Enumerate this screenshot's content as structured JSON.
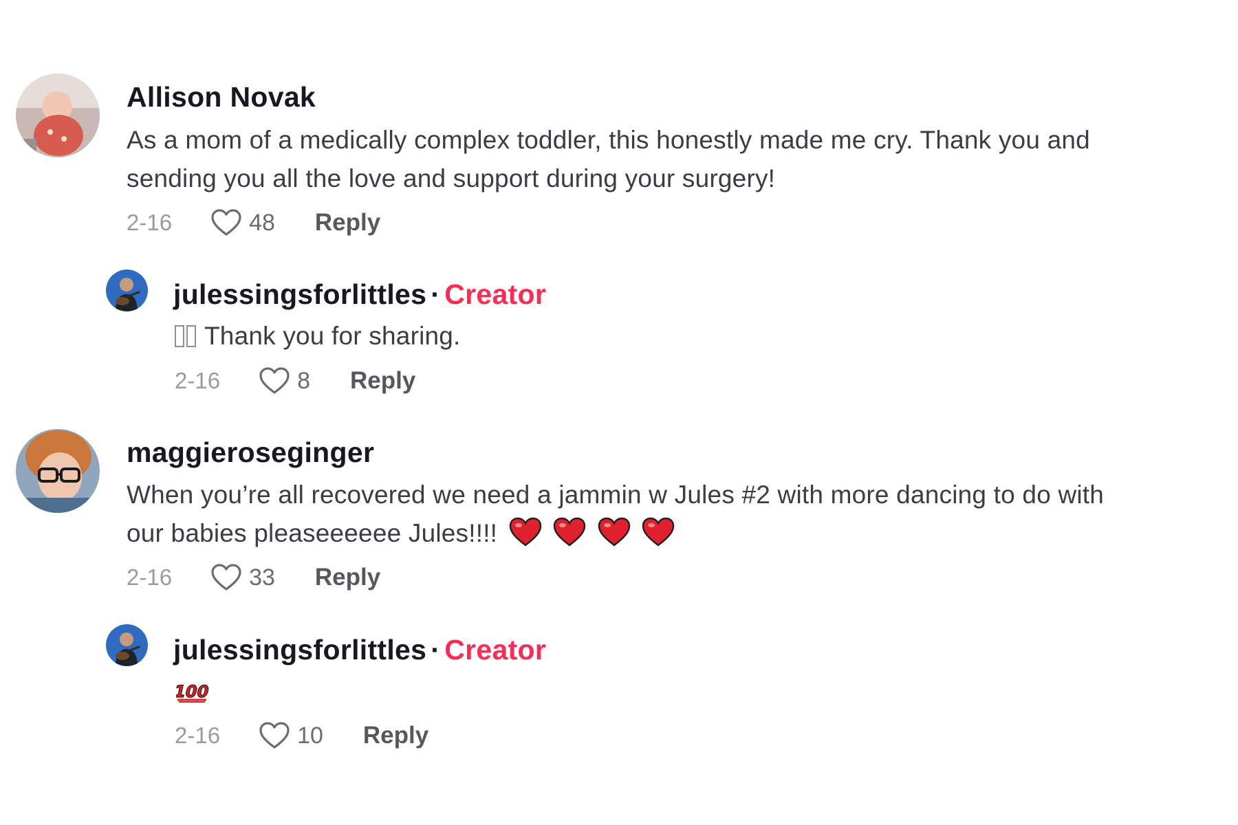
{
  "comments": [
    {
      "username": "Allison Novak",
      "text_lines": [
        "As a mom of a medically complex toddler, this honestly made me cry. Thank you and",
        "sending you all the love and support during your surgery!"
      ],
      "date": "2-16",
      "likes": "48",
      "reply_label": "Reply",
      "avatar_icon": "baby-photo-avatar",
      "reply": {
        "username": "julessingsforlittles",
        "separator": "·",
        "badge": "Creator",
        "text_prefix_icon": "missing-glyph-boxes",
        "text": "Thank you for sharing.",
        "date": "2-16",
        "likes": "8",
        "reply_label": "Reply",
        "avatar_icon": "guitar-player-avatar"
      }
    },
    {
      "username": "maggieroseginger",
      "text_lines": [
        "When you’re all recovered we need a jammin w Jules #2 with more dancing to do with",
        "our babies pleaseeeeee Jules!!!!"
      ],
      "text_suffix_icons": [
        "red-heart-emoji",
        "red-heart-emoji",
        "red-heart-emoji",
        "red-heart-emoji"
      ],
      "date": "2-16",
      "likes": "33",
      "reply_label": "Reply",
      "avatar_icon": "glasses-woman-avatar",
      "reply": {
        "username": "julessingsforlittles",
        "separator": "·",
        "badge": "Creator",
        "text_icon": "hundred-points-emoji",
        "date": "2-16",
        "likes": "10",
        "reply_label": "Reply",
        "avatar_icon": "guitar-player-avatar"
      }
    }
  ],
  "colors": {
    "creator_badge": "#fe2c55",
    "username": "#161823",
    "body_text": "#3b3c44",
    "date": "#9a9aa0",
    "heart_emoji": "#e0202d"
  }
}
